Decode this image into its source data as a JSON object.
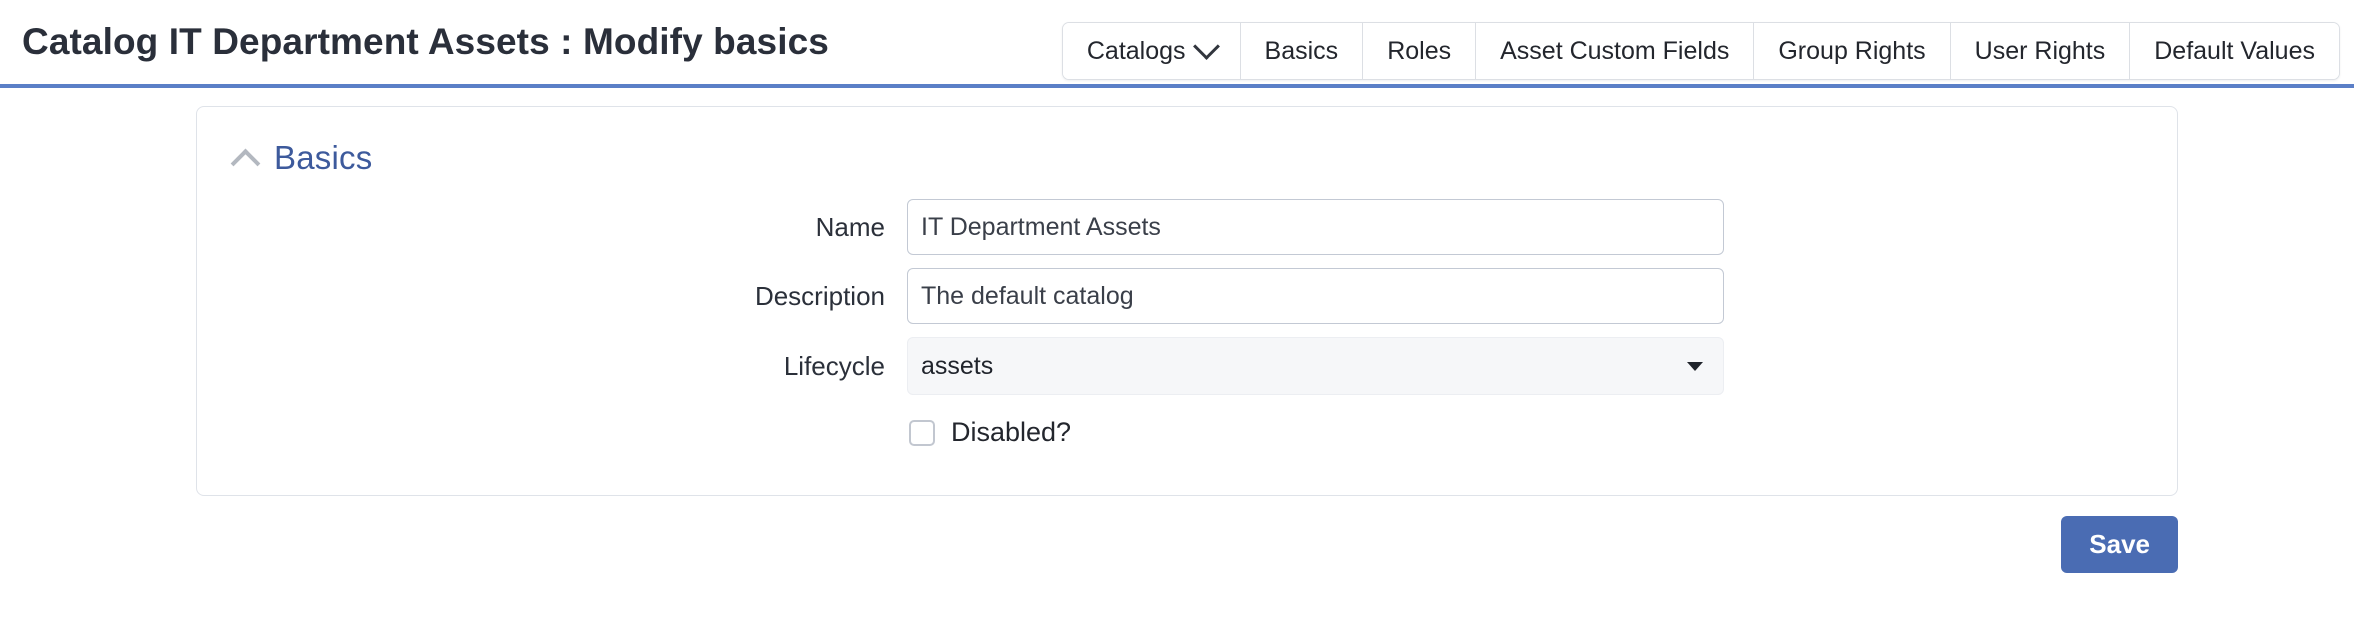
{
  "header": {
    "title": "Catalog IT Department Assets : Modify basics",
    "accent_color": "#5b7fc7",
    "tabs": [
      {
        "label": "Catalogs",
        "icon": "chevron-down-icon",
        "has_dropdown": true
      },
      {
        "label": "Basics",
        "has_dropdown": false
      },
      {
        "label": "Roles",
        "has_dropdown": false
      },
      {
        "label": "Asset Custom Fields",
        "has_dropdown": false
      },
      {
        "label": "Group Rights",
        "has_dropdown": false
      },
      {
        "label": "User Rights",
        "has_dropdown": false
      },
      {
        "label": "Default Values",
        "has_dropdown": false
      }
    ]
  },
  "card": {
    "collapse_icon": "chevron-up-icon",
    "section_title": "Basics",
    "section_title_color": "#3d5a9c",
    "fields": [
      {
        "label": "Name",
        "value": "IT Department Assets",
        "placeholder": "",
        "type": "text"
      },
      {
        "label": "Description",
        "value": "The default catalog",
        "placeholder": "",
        "type": "text"
      },
      {
        "label": "Lifecycle",
        "value": "assets",
        "type": "select",
        "icon": "caret-down-icon"
      }
    ],
    "checkbox": {
      "label": "Disabled?",
      "checked": false
    }
  },
  "footer": {
    "save_label": "Save",
    "save_color": "#4a6cb3"
  }
}
